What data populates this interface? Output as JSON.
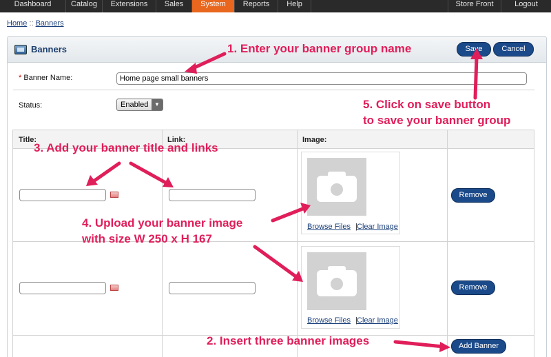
{
  "nav": {
    "items": [
      {
        "label": "Dashboard"
      },
      {
        "label": "Catalog"
      },
      {
        "label": "Extensions"
      },
      {
        "label": "Sales"
      },
      {
        "label": "System",
        "active": true
      },
      {
        "label": "Reports"
      },
      {
        "label": "Help"
      }
    ],
    "right": [
      {
        "label": "Store Front"
      },
      {
        "label": "Logout"
      }
    ]
  },
  "breadcrumb": {
    "home": "Home",
    "sep": "::",
    "current": "Banners"
  },
  "header": {
    "title": "Banners",
    "save": "Save",
    "cancel": "Cancel"
  },
  "form": {
    "name_label": "Banner Name:",
    "name_required": "*",
    "name_value": "Home page small banners",
    "status_label": "Status:",
    "status_value": "Enabled"
  },
  "table": {
    "col_title": "Title:",
    "col_link": "Link:",
    "col_image": "Image:",
    "rows": [
      {
        "browse": "Browse Files",
        "sep": "|",
        "clear": "Clear Image",
        "remove": "Remove"
      },
      {
        "browse": "Browse Files",
        "sep": "|",
        "clear": "Clear Image",
        "remove": "Remove"
      }
    ],
    "add": "Add Banner"
  },
  "annotations": {
    "step1": "1. Enter your banner group name",
    "step2": "2. Insert three banner images",
    "step3": "3. Add your banner title and links",
    "step4_line1": "4. Upload your banner image",
    "step4_line2": "with size W 250 x H 167",
    "step5_line1": "5. Click on save button",
    "step5_line2": "to save your banner group"
  },
  "colors": {
    "accent": "#e01e5a",
    "nav_active": "#e8661d",
    "button": "#1b4a8a",
    "title": "#1b3d6b"
  }
}
